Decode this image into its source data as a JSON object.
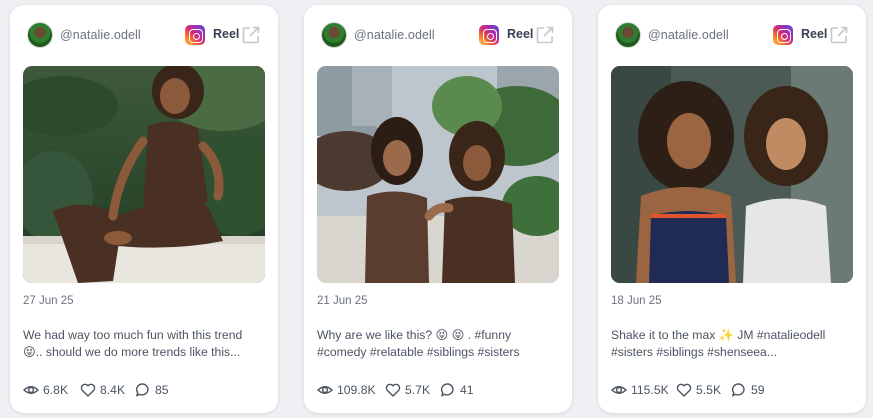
{
  "colors": {
    "page_background": "#eef0f3",
    "card_background": "#ffffff",
    "muted_text": "#6b7280"
  },
  "cards": [
    {
      "username": "@natalie.odell",
      "platform_icon": "instagram-icon",
      "type": "Reel",
      "date": "27 Jun 25",
      "caption_line1": "We had way too much fun with this trend",
      "caption_line2": "😝.. should we do more trends like this...",
      "views": "6.8K",
      "likes": "8.4K",
      "comments": "85"
    },
    {
      "username": "@natalie.odell",
      "platform_icon": "instagram-icon",
      "type": "Reel",
      "date": "21 Jun 25",
      "caption_line1": "Why are we like this? 😝 😝 . #funny",
      "caption_line2": "#comedy #relatable #siblings #sisters",
      "views": "109.8K",
      "likes": "5.7K",
      "comments": "41"
    },
    {
      "username": "@natalie.odell",
      "platform_icon": "instagram-icon",
      "type": "Reel",
      "date": "18 Jun 25",
      "caption_line1": "Shake it to the max ✨ JM #natalieodell",
      "caption_line2": "#sisters #siblings #shenseea...",
      "views": "115.5K",
      "likes": "5.5K",
      "comments": "59"
    }
  ]
}
